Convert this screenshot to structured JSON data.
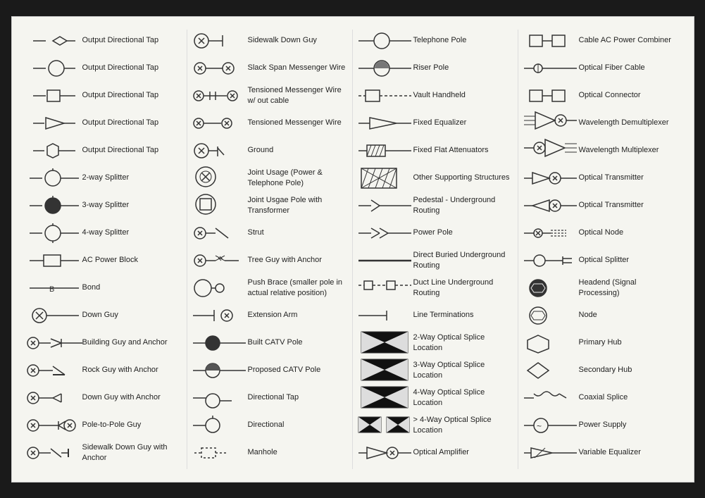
{
  "columns": [
    {
      "items": [
        {
          "id": "output-directional-tap-1",
          "label": "Output Directional Tap",
          "symbol": "diamond"
        },
        {
          "id": "output-directional-tap-2",
          "label": "Output Directional Tap",
          "symbol": "circle-line"
        },
        {
          "id": "output-directional-tap-3",
          "label": "Output Directional Tap",
          "symbol": "square-line"
        },
        {
          "id": "output-directional-tap-4",
          "label": "Output Directional Tap",
          "symbol": "triangle-line"
        },
        {
          "id": "output-directional-tap-5",
          "label": "Output Directional Tap",
          "symbol": "hexagon-line"
        },
        {
          "id": "2way-splitter",
          "label": "2-way Splitter",
          "symbol": "2way-splitter"
        },
        {
          "id": "3way-splitter",
          "label": "3-way Splitter",
          "symbol": "3way-splitter"
        },
        {
          "id": "4way-splitter",
          "label": "4-way Splitter",
          "symbol": "4way-splitter"
        },
        {
          "id": "ac-power-block",
          "label": "AC Power Block",
          "symbol": "ac-power-block"
        },
        {
          "id": "bond",
          "label": "Bond",
          "symbol": "bond"
        },
        {
          "id": "down-guy",
          "label": "Down Guy",
          "symbol": "down-guy"
        },
        {
          "id": "building-guy-anchor",
          "label": "Building Guy and Anchor",
          "symbol": "building-guy-anchor"
        },
        {
          "id": "rock-guy-anchor",
          "label": "Rock Guy with Anchor",
          "symbol": "rock-guy-anchor"
        },
        {
          "id": "down-guy-anchor",
          "label": "Down Guy with Anchor",
          "symbol": "down-guy-anchor"
        },
        {
          "id": "pole-to-pole-guy",
          "label": "Pole-to-Pole Guy",
          "symbol": "pole-to-pole-guy"
        },
        {
          "id": "sidewalk-down-guy-anchor",
          "label": "Sidewalk Down Guy with Anchor",
          "symbol": "sidewalk-down-guy-anchor"
        }
      ]
    },
    {
      "items": [
        {
          "id": "sidewalk-down-guy",
          "label": "Sidewalk Down Guy",
          "symbol": "sidewalk-down-guy"
        },
        {
          "id": "slack-span-messenger",
          "label": "Slack Span Messenger Wire",
          "symbol": "slack-span-messenger"
        },
        {
          "id": "tensioned-messenger-wo-cable",
          "label": "Tensioned Messenger Wire w/ out cable",
          "symbol": "tensioned-messenger-wo-cable"
        },
        {
          "id": "tensioned-messenger",
          "label": "Tensioned Messenger Wire",
          "symbol": "tensioned-messenger"
        },
        {
          "id": "ground",
          "label": "Ground",
          "symbol": "ground"
        },
        {
          "id": "joint-usage",
          "label": "Joint Usage (Power & Telephone Pole)",
          "symbol": "joint-usage"
        },
        {
          "id": "joint-usgae-transformer",
          "label": "Joint Usgae Pole with Transformer",
          "symbol": "joint-usgae-transformer"
        },
        {
          "id": "strut",
          "label": "Strut",
          "symbol": "strut"
        },
        {
          "id": "tree-guy-anchor",
          "label": "Tree Guy with Anchor",
          "symbol": "tree-guy-anchor"
        },
        {
          "id": "push-brace",
          "label": "Push Brace (smaller pole in actual relative position)",
          "symbol": "push-brace"
        },
        {
          "id": "extension-arm",
          "label": "Extension Arm",
          "symbol": "extension-arm"
        },
        {
          "id": "built-catv-pole",
          "label": "Built CATV Pole",
          "symbol": "built-catv-pole"
        },
        {
          "id": "proposed-catv-pole",
          "label": "Proposed CATV Pole",
          "symbol": "proposed-catv-pole"
        },
        {
          "id": "directional-tap-1",
          "label": "Directional Tap",
          "symbol": "directional-tap-1"
        },
        {
          "id": "directional-tap-2",
          "label": "Directional",
          "symbol": "directional-tap-2"
        },
        {
          "id": "manhole",
          "label": "Manhole",
          "symbol": "manhole"
        }
      ]
    },
    {
      "items": [
        {
          "id": "telephone-pole",
          "label": "Telephone Pole",
          "symbol": "telephone-pole"
        },
        {
          "id": "riser-pole",
          "label": "Riser Pole",
          "symbol": "riser-pole"
        },
        {
          "id": "vault-handheld",
          "label": "Vault Handheld",
          "symbol": "vault-handheld"
        },
        {
          "id": "fixed-equalizer",
          "label": "Fixed Equalizer",
          "symbol": "fixed-equalizer"
        },
        {
          "id": "fixed-flat-attenuators",
          "label": "Fixed Flat Attenuators",
          "symbol": "fixed-flat-attenuators"
        },
        {
          "id": "other-supporting",
          "label": "Other Supporting Structures",
          "symbol": "other-supporting"
        },
        {
          "id": "pedestal-underground",
          "label": "Pedestal - Underground Routing",
          "symbol": "pedestal-underground"
        },
        {
          "id": "power-pole",
          "label": "Power Pole",
          "symbol": "power-pole"
        },
        {
          "id": "direct-buried",
          "label": "Direct Buried Underground Routing",
          "symbol": "direct-buried"
        },
        {
          "id": "duct-line",
          "label": "Duct Line Underground Routing",
          "symbol": "duct-line"
        },
        {
          "id": "line-terminations",
          "label": "Line Terminations",
          "symbol": "line-terminations"
        },
        {
          "id": "2way-optical-splice",
          "label": "2-Way Optical Splice Location",
          "symbol": "2way-optical-splice"
        },
        {
          "id": "3way-optical-splice",
          "label": "3-Way Optical Splice Location",
          "symbol": "3way-optical-splice"
        },
        {
          "id": "4way-optical-splice",
          "label": "4-Way Optical Splice Location",
          "symbol": "4way-optical-splice"
        },
        {
          "id": "4way-plus-optical-splice",
          "label": "> 4-Way Optical Splice Location",
          "symbol": "4way-plus-optical-splice"
        },
        {
          "id": "optical-amplifier",
          "label": "Optical Amplifier",
          "symbol": "optical-amplifier"
        }
      ]
    },
    {
      "items": [
        {
          "id": "cable-ac-power-combiner",
          "label": "Cable AC Power Combiner",
          "symbol": "cable-ac-power-combiner"
        },
        {
          "id": "optical-fiber-cable",
          "label": "Optical Fiber Cable",
          "symbol": "optical-fiber-cable"
        },
        {
          "id": "optical-connector",
          "label": "Optical Connector",
          "symbol": "optical-connector"
        },
        {
          "id": "wavelength-demultiplexer",
          "label": "Wavelength Demultiplexer",
          "symbol": "wavelength-demultiplexer"
        },
        {
          "id": "wavelength-multiplexer",
          "label": "Wavelength Multiplexer",
          "symbol": "wavelength-multiplexer"
        },
        {
          "id": "optical-transmitter-1",
          "label": "Optical Transmitter",
          "symbol": "optical-transmitter-1"
        },
        {
          "id": "optical-transmitter-2",
          "label": "Optical Transmitter",
          "symbol": "optical-transmitter-2"
        },
        {
          "id": "optical-node",
          "label": "Optical Node",
          "symbol": "optical-node"
        },
        {
          "id": "optical-splitter",
          "label": "Optical Splitter",
          "symbol": "optical-splitter"
        },
        {
          "id": "headend",
          "label": "Headend (Signal Processing)",
          "symbol": "headend"
        },
        {
          "id": "node",
          "label": "Node",
          "symbol": "node"
        },
        {
          "id": "primary-hub",
          "label": "Primary Hub",
          "symbol": "primary-hub"
        },
        {
          "id": "secondary-hub",
          "label": "Secondary Hub",
          "symbol": "secondary-hub"
        },
        {
          "id": "coaxial-splice",
          "label": "Coaxial Splice",
          "symbol": "coaxial-splice"
        },
        {
          "id": "power-supply",
          "label": "Power Supply",
          "symbol": "power-supply"
        },
        {
          "id": "variable-equalizer",
          "label": "Variable Equalizer",
          "symbol": "variable-equalizer"
        }
      ]
    }
  ]
}
